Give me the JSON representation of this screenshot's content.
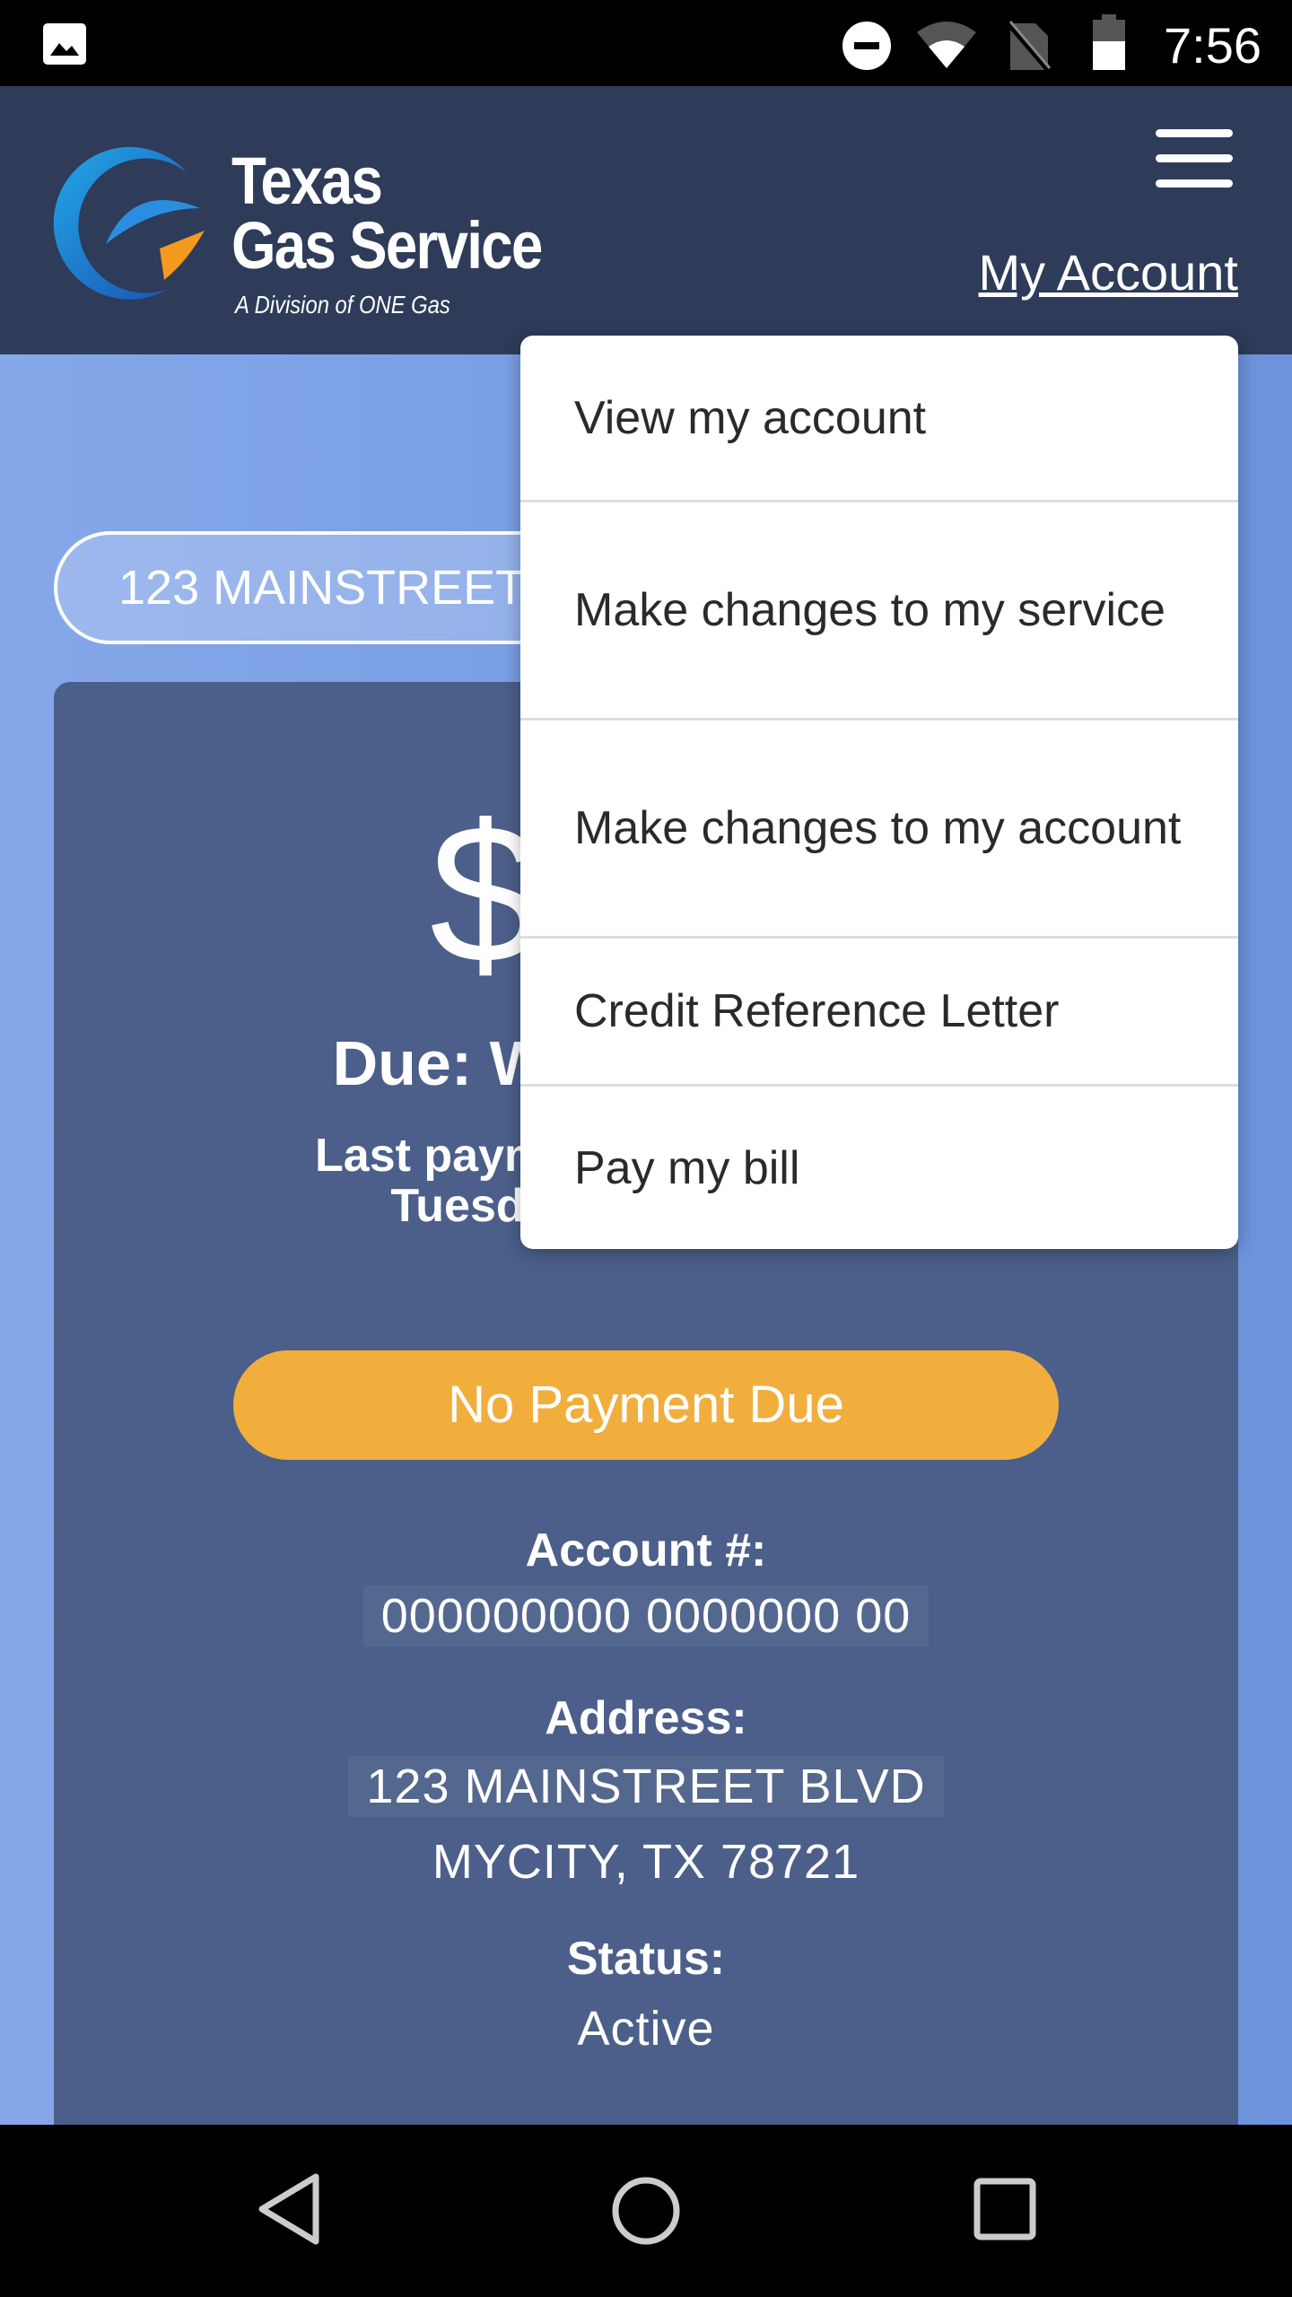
{
  "status_bar": {
    "time": "7:56",
    "icons": [
      "image-icon",
      "do-not-disturb-icon",
      "wifi-icon",
      "no-sim-icon",
      "battery-icon"
    ]
  },
  "header": {
    "brand_line1": "Texas",
    "brand_line2": "Gas Service",
    "brand_tagline": "A Division of ONE Gas",
    "my_account": "My Account",
    "menu_icon": "hamburger-icon"
  },
  "address_selector": {
    "value": "123 MAINSTREET BLVD"
  },
  "summary": {
    "amount": "$",
    "due": "Due: We",
    "last_payment": "Last paymen",
    "last_payment_day": "Tuesd",
    "pay_button": "No Payment Due",
    "account_label": "Account #:",
    "account_number": "000000000 0000000 00",
    "address_label": "Address:",
    "address_line1": "123 MAINSTREET BLVD",
    "address_line2": "MYCITY, TX 78721",
    "status_label": "Status:",
    "status_value": "Active"
  },
  "dropdown": {
    "items": [
      {
        "label": "View my account"
      },
      {
        "label": "Make changes to my service"
      },
      {
        "label": "Make changes to my account"
      },
      {
        "label": "Credit Reference Letter"
      },
      {
        "label": "Pay my bill"
      }
    ]
  },
  "colors": {
    "header": "#2e3b59",
    "card": "#4b5f8a",
    "pay_button": "#f1ae3d",
    "background": "#779ce3"
  }
}
